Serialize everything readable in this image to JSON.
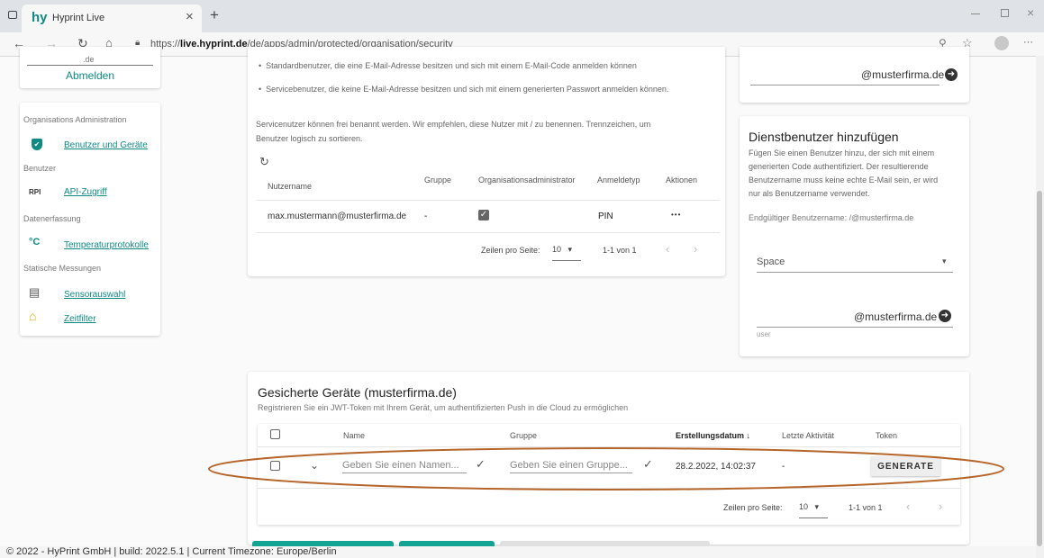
{
  "browser": {
    "tab_title": "Hyprint Live",
    "tab_logo": "hy",
    "url_prefix": "https://",
    "url_host": "live.hyprint.de",
    "url_path": "/de/apps/admin/protected/organisation/security",
    "new_tab_glyph": "+",
    "close_glyph": "×",
    "more_glyph": "···"
  },
  "sidebar": {
    "top_partial": ".de",
    "logout": "Abmelden",
    "section_title": "Organisations Administration",
    "groups": [
      {
        "heading": "",
        "items": [
          {
            "icon": "shield-check-icon",
            "glyph": "✔",
            "label": "Benutzer und Geräte"
          }
        ]
      },
      {
        "heading": "Benutzer",
        "items": [
          {
            "icon": "api-icon",
            "glyph": "RPI",
            "label": "API-Zugriff"
          }
        ]
      },
      {
        "heading": "Datenerfassung",
        "items": [
          {
            "icon": "temperature-icon",
            "glyph": "°C",
            "label": "Temperaturprotokolle"
          }
        ]
      },
      {
        "heading": "Statische Messungen",
        "items": [
          {
            "icon": "sensor-list-icon",
            "glyph": "▤",
            "label": "Sensorauswahl"
          },
          {
            "icon": "time-filter-icon",
            "glyph": "⌂",
            "label": "Zeitfilter"
          }
        ]
      }
    ]
  },
  "main": {
    "bullets": [
      "Standardbenutzer, die eine E-Mail-Adresse besitzen und sich mit einem E-Mail-Code anmelden können",
      "Servicebenutzer, die keine E-Mail-Adresse besitzen und sich mit einem generierten Passwort anmelden können."
    ],
    "service_info_line1": "Servicenutzer können frei benannt werden. Wir empfehlen, diese Nutzer mit / zu benennen. Trennzeichen, um",
    "service_info_line2": "Benutzer logisch zu sortieren.",
    "users_table": {
      "headers": [
        "Nutzername",
        "Gruppe",
        "Organisationsadministrator",
        "Anmeldetyp",
        "Aktionen"
      ],
      "rows": [
        {
          "username": "max.mustermann@musterfirma.de",
          "group": "-",
          "admin": true,
          "login_type": "PIN",
          "actions": "•••"
        }
      ],
      "rows_per_page_label": "Zeilen pro Seite:",
      "rows_per_page": "10",
      "range": "1-1 von 1"
    }
  },
  "right_panel": {
    "top_domain": "@musterfirma.de",
    "service_user": {
      "title": "Dienstbenutzer hinzufügen",
      "desc_line1": "Fügen Sie einen Benutzer hinzu, der sich mit einem",
      "desc_line2": "generierten Code authentifiziert. Der resultierende",
      "desc_line3": "Benutzername muss keine echte E-Mail sein, er wird",
      "desc_line4": "nur als Benutzername verwendet.",
      "final_username": "Endgültiger Benutzername: /@musterfirma.de",
      "space_select": "Space",
      "domain": "@musterfirma.de",
      "hint": "user"
    }
  },
  "devices": {
    "title": "Gesicherte Geräte (musterfirma.de)",
    "subtitle": "Registrieren Sie ein JWT-Token mit Ihrem Gerät, um authentifizierten Push in die Cloud zu ermöglichen",
    "headers": {
      "name": "Name",
      "group": "Gruppe",
      "created": "Erstellungsdatum",
      "last_activity": "Letzte Aktivität",
      "token": "Token"
    },
    "new_row": {
      "name_placeholder": "Geben Sie einen Namen...",
      "group_placeholder": "Geben Sie einen Gruppe...",
      "created": "28.2.2022, 14:02:37",
      "last_activity": "-",
      "generate": "GENERATE"
    },
    "rows_per_page_label": "Zeilen pro Seite:",
    "rows_per_page": "10",
    "range": "1-1 von 1"
  },
  "footer": {
    "text": "© 2022 - HyPrint GmbH | build: 2022.5.1 | Current Timezone: Europe/Berlin"
  },
  "colors": {
    "accent": "#0e8a83",
    "highlight": "#b5652a",
    "button": "#13a392"
  }
}
